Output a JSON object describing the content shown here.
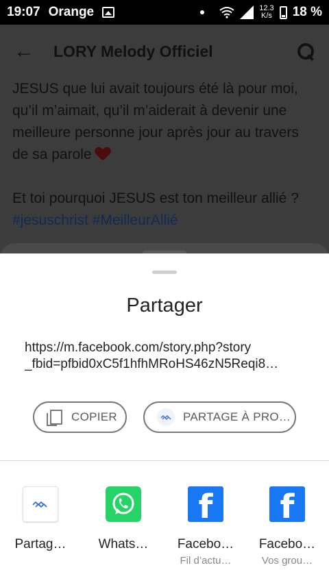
{
  "status_bar": {
    "time": "19:07",
    "carrier": "Orange",
    "speed_value": "12.3",
    "speed_unit": "K/s",
    "battery": "18 %"
  },
  "app_bar": {
    "title": "LORY Melody Officiel"
  },
  "post": {
    "paragraph1": "JESUS que lui avait toujours été là pour moi, qu’il m’aimait, qu’il m’aiderait à devenir une meilleure personne jour après jour au travers de sa parole",
    "paragraph2": "Et toi pourquoi JESUS est ton meilleur allié ?",
    "hashtags": "#jesuschrist #MeilleurAllié"
  },
  "share_sheet": {
    "title": "Partager",
    "url_line1": "https://m.facebook.com/story.php?story",
    "url_line2": "_fbid=pfbid0xC5f1hfhMRoHS46zN5Reqi8…",
    "copy_label": "COPIER",
    "nearby_label": "PARTAGE À PRO…",
    "targets": [
      {
        "label": "Partag…",
        "sub": "",
        "icon": "nearby-share-icon"
      },
      {
        "label": "Whats…",
        "sub": "",
        "icon": "whatsapp-icon"
      },
      {
        "label": "Facebo…",
        "sub": "Fil d’actu…",
        "icon": "facebook-icon"
      },
      {
        "label": "Facebo…",
        "sub": "Vos grou…",
        "icon": "facebook-icon"
      }
    ]
  },
  "colors": {
    "whatsapp": "#25d366",
    "facebook": "#1877f2",
    "hashtag": "#102a55"
  }
}
